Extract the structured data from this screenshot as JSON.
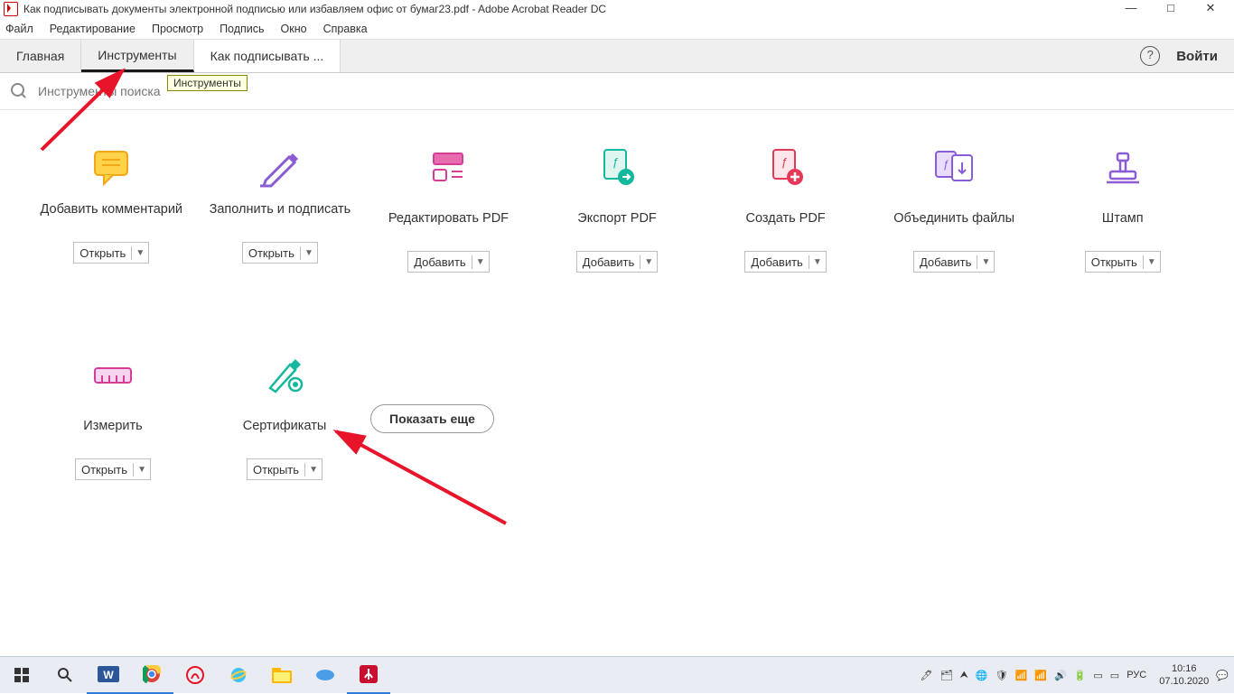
{
  "window": {
    "title": "Как подписывать документы электронной подписью или избавляем офис от бумаг23.pdf - Adobe Acrobat Reader DC"
  },
  "menu": {
    "file": "Файл",
    "edit": "Редактирование",
    "view": "Просмотр",
    "sign": "Подпись",
    "window": "Окно",
    "help": "Справка"
  },
  "tabs": {
    "home": "Главная",
    "tools": "Инструменты",
    "doc": "Как подписывать ..."
  },
  "toolbar": {
    "login": "Войти"
  },
  "search": {
    "placeholder": "Инструменты поиска"
  },
  "tooltip": {
    "tools": "Инструменты"
  },
  "buttons": {
    "open": "Открыть",
    "add": "Добавить",
    "showmore": "Показать еще"
  },
  "tools": [
    {
      "label": "Добавить комментарий",
      "action": "open",
      "icon": "comment"
    },
    {
      "label": "Заполнить и подписать",
      "action": "open",
      "icon": "sign"
    },
    {
      "label": "Редактировать PDF",
      "action": "add",
      "icon": "edit",
      "single": true
    },
    {
      "label": "Экспорт PDF",
      "action": "add",
      "icon": "export",
      "single": true
    },
    {
      "label": "Создать PDF",
      "action": "add",
      "icon": "create",
      "single": true
    },
    {
      "label": "Объединить файлы",
      "action": "add",
      "icon": "combine",
      "single": true
    },
    {
      "label": "Штамп",
      "action": "open",
      "icon": "stamp",
      "single": true
    },
    {
      "label": "Измерить",
      "action": "open",
      "icon": "measure",
      "single": true
    },
    {
      "label": "Сертификаты",
      "action": "open",
      "icon": "cert",
      "single": true
    }
  ],
  "tray": {
    "lang": "РУС",
    "time": "10:16",
    "date": "07.10.2020"
  }
}
